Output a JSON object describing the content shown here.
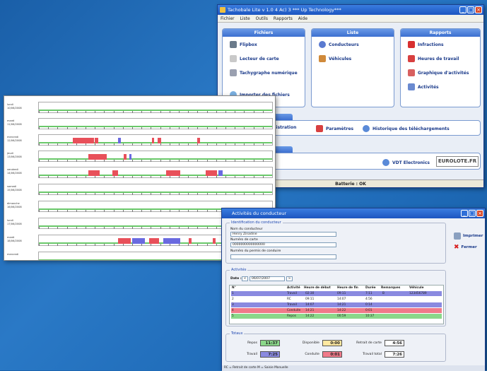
{
  "main_window": {
    "title": "Tachobale Lite v 1.0 4 Ac) 3   *** Up Technology***",
    "menu": [
      "Fichier",
      "Liste",
      "Outils",
      "Rapports",
      "Aide"
    ],
    "panels": [
      {
        "header": "Fichiers",
        "items": [
          "Flipbox",
          "Lecteur de carte",
          "Tachygraphe numérique",
          "Importer des fichiers"
        ]
      },
      {
        "header": "Liste",
        "items": [
          "Conducteurs",
          "Véhicules"
        ]
      },
      {
        "header": "Rapports",
        "items": [
          "Infractions",
          "Heures de travail",
          "Graphique d'activités",
          "Activités"
        ]
      }
    ],
    "admin_items": [
      "Administration",
      "Paramètres",
      "Historique des téléchargements"
    ],
    "footer_link": "VDT Electronics",
    "footer_logo": "EUROLOTE.FR",
    "status": "Batterie : OK"
  },
  "report": {
    "days": [
      {
        "l1": "lundi",
        "l2": "10/06/2008"
      },
      {
        "l1": "mardi",
        "l2": "11/06/2008"
      },
      {
        "l1": "mercredi",
        "l2": "12/06/2008"
      },
      {
        "l1": "jeudi",
        "l2": "13/06/2008"
      },
      {
        "l1": "vendredi",
        "l2": "14/06/2008"
      },
      {
        "l1": "samedi",
        "l2": "15/06/2008"
      },
      {
        "l1": "dimanche",
        "l2": "16/06/2008"
      },
      {
        "l1": "lundi",
        "l2": "17/06/2008"
      },
      {
        "l1": "mardi",
        "l2": "18/06/2008"
      },
      {
        "l1": "mercredi",
        "l2": ""
      }
    ]
  },
  "activity_window": {
    "title": "Activités du conducteur",
    "ident_group": "Identification du conducteur",
    "name_label": "Nom du conducteur",
    "name_value": "Henry Zinadine",
    "card_label": "Numéro de carte",
    "card_value": "0000000000000000",
    "permit_label": "Numéro du permis de conduire",
    "permit_value": "",
    "activity_group": "Activités",
    "date_label": "Date :",
    "date_value": "06/07/2007",
    "nav_prev": "<",
    "nav_next": ">",
    "print_label": "Imprimer",
    "close_label": "Fermer",
    "columns": [
      "N°",
      "",
      "Activité",
      "Heure de début",
      "Heure de fin",
      "Durée",
      "Remarques",
      "Véhicule"
    ],
    "rows": [
      {
        "n": "1",
        "act": "Travail",
        "start": "02:30",
        "end": "09:11",
        "dur": "7:11",
        "rem": "B",
        "veh": "123456789",
        "color": "#8a8ae0"
      },
      {
        "n": "2",
        "act": "RC",
        "start": "09:11",
        "end": "14:07",
        "dur": "4:56",
        "rem": "",
        "veh": "",
        "color": "#ffffff"
      },
      {
        "n": "3",
        "act": "Travail",
        "start": "14:07",
        "end": "14:21",
        "dur": "0:14",
        "rem": "",
        "veh": "",
        "color": "#8a8ae0"
      },
      {
        "n": "4",
        "act": "Conduite",
        "start": "14:21",
        "end": "14:22",
        "dur": "0:01",
        "rem": "",
        "veh": "",
        "color": "#f07a8a"
      },
      {
        "n": "5",
        "act": "Repos",
        "start": "14:22",
        "end": "00:59",
        "dur": "10:37",
        "rem": "",
        "veh": "",
        "color": "#8ad88a"
      }
    ],
    "totals_group": "Totaux",
    "totals": [
      {
        "label": "Repos",
        "value": "11:37",
        "color": "#8ad88a"
      },
      {
        "label": "Disponible",
        "value": "0:00",
        "color": "#ffe8a0"
      },
      {
        "label": "Retrait de carte",
        "value": "4:56",
        "color": "#ffffff"
      },
      {
        "label": "Travail",
        "value": "7:25",
        "color": "#8a8ae0"
      },
      {
        "label": "Conduite",
        "value": "0:01",
        "color": "#f07a8a"
      },
      {
        "label": "Travail total",
        "value": "7:26",
        "color": "#ffffff"
      }
    ],
    "footer": "RC = Retrait de carte  M = Saisie Manuelle"
  }
}
